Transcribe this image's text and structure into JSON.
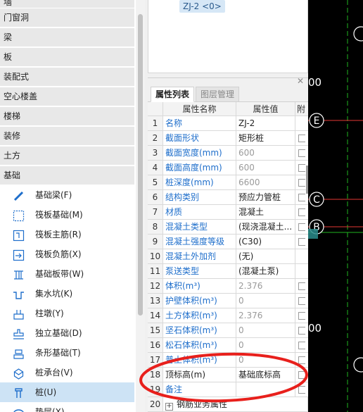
{
  "category_tree": {
    "categories": [
      "门窗洞",
      "梁",
      "板",
      "装配式",
      "空心楼盖",
      "楼梯",
      "装修",
      "土方",
      "基础"
    ],
    "sub_items": [
      {
        "label": "基础梁(F)",
        "icon": "foundation-beam-icon"
      },
      {
        "label": "筏板基础(M)",
        "icon": "raft-foundation-icon"
      },
      {
        "label": "筏板主筋(R)",
        "icon": "raft-main-rebar-icon"
      },
      {
        "label": "筏板负筋(X)",
        "icon": "raft-negative-rebar-icon"
      },
      {
        "label": "基础板带(W)",
        "icon": "foundation-strip-icon"
      },
      {
        "label": "集水坑(K)",
        "icon": "sump-pit-icon"
      },
      {
        "label": "柱墩(Y)",
        "icon": "column-pier-icon"
      },
      {
        "label": "独立基础(D)",
        "icon": "isolated-footing-icon"
      },
      {
        "label": "条形基础(T)",
        "icon": "strip-footing-icon"
      },
      {
        "label": "桩承台(V)",
        "icon": "pile-cap-icon"
      },
      {
        "label": "桩(U)",
        "icon": "pile-icon",
        "selected": true
      },
      {
        "label": "垫层(X)",
        "icon": "cushion-icon"
      }
    ]
  },
  "preview": {
    "component_tag": "ZJ-2 <0>"
  },
  "property_panel": {
    "tabs": [
      {
        "label": "属性列表",
        "active": true
      },
      {
        "label": "图层管理",
        "active": false
      }
    ],
    "columns": [
      "属性名称",
      "属性值",
      "附"
    ],
    "rows": [
      {
        "n": "1",
        "name": "名称",
        "value": "ZJ-2",
        "check": false
      },
      {
        "n": "2",
        "name": "截面形状",
        "value": "矩形桩",
        "check": true
      },
      {
        "n": "3",
        "name": "截面宽度(mm)",
        "value": "600",
        "gray": true,
        "check": true
      },
      {
        "n": "4",
        "name": "截面高度(mm)",
        "value": "600",
        "gray": true,
        "check": true
      },
      {
        "n": "5",
        "name": "桩深度(mm)",
        "value": "6600",
        "gray": true,
        "check": true
      },
      {
        "n": "6",
        "name": "结构类别",
        "value": "预应力管桩",
        "check": true
      },
      {
        "n": "7",
        "name": "材质",
        "value": "混凝土",
        "check": true
      },
      {
        "n": "8",
        "name": "混凝土类型",
        "value": "(现浇混凝土...",
        "check": true
      },
      {
        "n": "9",
        "name": "混凝土强度等级",
        "value": "(C30)",
        "check": true
      },
      {
        "n": "10",
        "name": "混凝土外加剂",
        "value": "(无)",
        "check": false
      },
      {
        "n": "11",
        "name": "泵送类型",
        "value": "(混凝土泵)",
        "check": false
      },
      {
        "n": "12",
        "name": "体积(m³)",
        "value": "2.376",
        "gray": true,
        "check": true
      },
      {
        "n": "13",
        "name": "护壁体积(m³)",
        "value": "0",
        "gray": true,
        "check": true
      },
      {
        "n": "14",
        "name": "土方体积(m³)",
        "value": "2.376",
        "gray": true,
        "check": true
      },
      {
        "n": "15",
        "name": "坚石体积(m³)",
        "value": "0",
        "gray": true,
        "check": true
      },
      {
        "n": "16",
        "name": "松石体积(m³)",
        "value": "0",
        "gray": true,
        "check": true
      },
      {
        "n": "17",
        "name": "普土体积(m³)",
        "value": "0",
        "gray": true,
        "check": true
      },
      {
        "n": "18",
        "name": "顶标高(m)",
        "value": "基础底标高",
        "dark": true,
        "check": true
      },
      {
        "n": "19",
        "name": "备注",
        "value": "",
        "check": true
      },
      {
        "n": "20",
        "name": "钢筋业务属性",
        "value": "",
        "group": true,
        "check": false
      }
    ],
    "highlighted_row": "18"
  },
  "cad_canvas": {
    "axis_labels": [
      "E",
      "C",
      "B"
    ],
    "partial_labels": [
      "00",
      "00"
    ],
    "colors": {
      "background": "#000000",
      "axis_line": "#e53935",
      "grid_line": "#1fb51f",
      "label": "#ffffff",
      "annotation": "#e8201c"
    }
  }
}
